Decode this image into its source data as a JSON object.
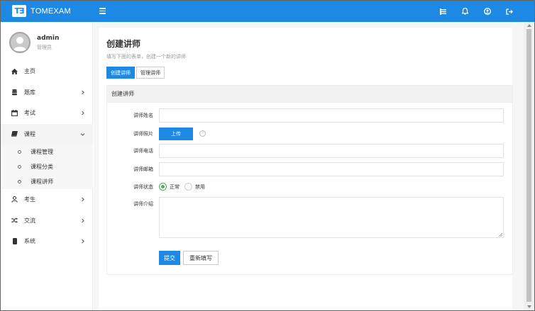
{
  "app": {
    "logo_mark": "T∃",
    "name": "TOMEXAM"
  },
  "colors": {
    "primary": "#1e88e5",
    "radio_on": "#4caf50"
  },
  "header_icons": [
    "list-icon",
    "bell-icon",
    "user-icon",
    "logout-icon"
  ],
  "user": {
    "name": "admin",
    "role": "管理员"
  },
  "nav": {
    "items": [
      {
        "label": "主页",
        "icon": "home-icon"
      },
      {
        "label": "题库",
        "icon": "database-icon"
      },
      {
        "label": "考试",
        "icon": "calendar-icon"
      },
      {
        "label": "课程",
        "icon": "book-icon"
      },
      {
        "label": "考生",
        "icon": "user-outline-icon"
      },
      {
        "label": "交流",
        "icon": "shuffle-icon"
      },
      {
        "label": "系统",
        "icon": "mobile-icon"
      }
    ],
    "sub_items": [
      "课程管理",
      "课程分类",
      "课程讲师"
    ]
  },
  "page": {
    "title": "创建讲师",
    "description": "填写下面的表单，创建一个新的讲师",
    "tabs": [
      "创建讲师",
      "管理讲师"
    ]
  },
  "form": {
    "section_title": "创建讲师",
    "name_label": "讲师姓名",
    "photo_label": "讲师照片",
    "upload_label": "上传",
    "help_mark": "?",
    "phone_label": "讲师电话",
    "email_label": "讲师邮箱",
    "status_label": "讲师状态",
    "status_options": [
      "正常",
      "禁用"
    ],
    "intro_label": "讲师介绍",
    "submit_label": "提交",
    "reset_label": "重新填写"
  }
}
